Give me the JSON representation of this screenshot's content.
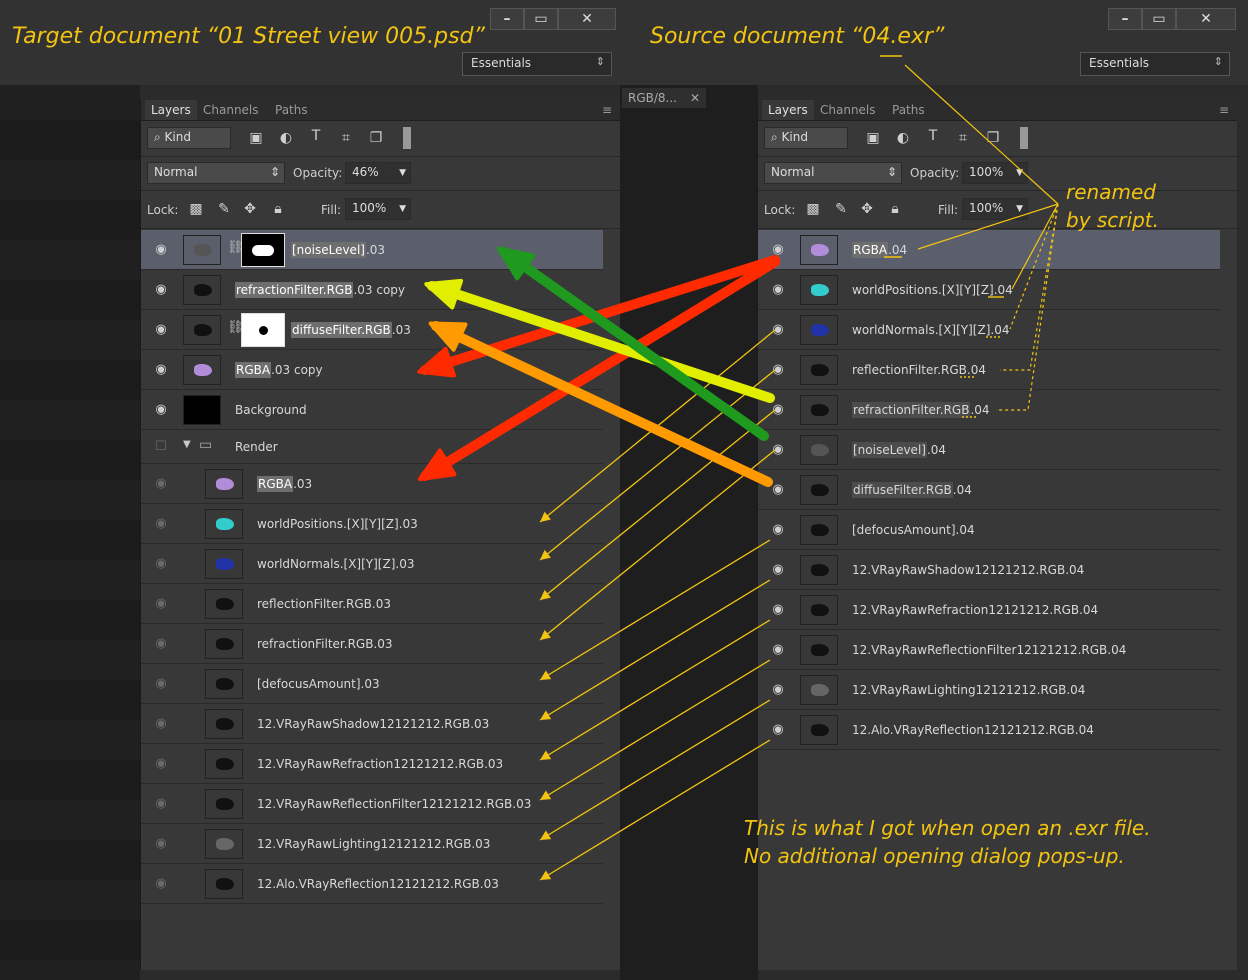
{
  "captions": {
    "target": "Target document “01 Street view 005.psd”",
    "source": "Source document “04.exr”",
    "renamed_line1": "renamed",
    "renamed_line2": "by script.",
    "note_line1": "This is what I got when open an .exr file.",
    "note_line2": "No additional opening dialog pops-up."
  },
  "window_controls": {
    "minimize": "–",
    "restore": "▭",
    "close": "✕"
  },
  "workspace": {
    "left_value": "Essentials",
    "right_value": "Essentials"
  },
  "doc_tab": {
    "label": "RGB/8...",
    "close": "✕"
  },
  "colors": {
    "caption": "#f2c411",
    "arrow_red": "#ff2a00",
    "arrow_yellow": "#e2ee00",
    "arrow_orange": "#ff9a00",
    "arrow_green": "#1f9a1f"
  },
  "left_panel": {
    "tabs": [
      "Layers",
      "Channels",
      "Paths"
    ],
    "filter_kind": "Kind",
    "blend_mode": "Normal",
    "opacity_label": "Opacity:",
    "opacity_value": "46%",
    "lock_label": "Lock:",
    "fill_label": "Fill:",
    "fill_value": "100%",
    "layers": [
      {
        "pre": "[noiseLevel]",
        "post": ".03",
        "visible": true,
        "selected": true,
        "thumb_icon": "layer-thumbnail-icon"
      },
      {
        "pre": "refractionFilter.RGB",
        "post": ".03 copy",
        "visible": true
      },
      {
        "pre": "diffuseFilter.RGB",
        "post": ".03",
        "visible": true
      },
      {
        "pre": "RGBA",
        "post": ".03 copy",
        "visible": true
      },
      {
        "pre": "Background",
        "post": "",
        "visible": true
      },
      {
        "pre": "Render",
        "post": "",
        "visible": false,
        "group": true
      },
      {
        "pre": "RGBA",
        "post": ".03",
        "visible": false
      },
      {
        "pre": "worldPositions.[X][Y][Z]",
        "post": ".03",
        "visible": false
      },
      {
        "pre": "worldNormals.[X][Y][Z]",
        "post": ".03",
        "visible": false
      },
      {
        "pre": "reflectionFilter.RGB",
        "post": ".03",
        "visible": false
      },
      {
        "pre": "refractionFilter.RGB",
        "post": ".03",
        "visible": false
      },
      {
        "pre": "[defocusAmount]",
        "post": ".03",
        "visible": false
      },
      {
        "pre": "12.VRayRawShadow12121212.RGB",
        "post": ".03",
        "visible": false
      },
      {
        "pre": "12.VRayRawRefraction12121212.RGB",
        "post": ".03",
        "visible": false
      },
      {
        "pre": "12.VRayRawReflectionFilter12121212.RGB",
        "post": ".03",
        "visible": false
      },
      {
        "pre": "12.VRayRawLighting12121212.RGB",
        "post": ".03",
        "visible": false
      },
      {
        "pre": "12.Alo.VRayReflection12121212.RGB",
        "post": ".03",
        "visible": false
      }
    ]
  },
  "right_panel": {
    "tabs": [
      "Layers",
      "Channels",
      "Paths"
    ],
    "filter_kind": "Kind",
    "blend_mode": "Normal",
    "opacity_label": "Opacity:",
    "opacity_value": "100%",
    "lock_label": "Lock:",
    "fill_label": "Fill:",
    "fill_value": "100%",
    "layers": [
      {
        "pre": "RGBA",
        "post": ".04"
      },
      {
        "pre": "worldPositions.[X][Y][Z]",
        "post": ".04"
      },
      {
        "pre": "worldNormals.[X][Y][Z]",
        "post": ".04"
      },
      {
        "pre": "reflectionFilter.RGB",
        "post": ".04"
      },
      {
        "pre": "refractionFilter.RGB",
        "post": ".04"
      },
      {
        "pre": "[noiseLevel]",
        "post": ".04"
      },
      {
        "pre": "diffuseFilter.RGB",
        "post": ".04"
      },
      {
        "pre": "[defocusAmount]",
        "post": ".04"
      },
      {
        "pre": "12.VRayRawShadow12121212.RGB",
        "post": ".04"
      },
      {
        "pre": "12.VRayRawRefraction12121212.RGB",
        "post": ".04"
      },
      {
        "pre": "12.VRayRawReflectionFilter12121212.RGB",
        "post": ".04"
      },
      {
        "pre": "12.VRayRawLighting12121212.RGB",
        "post": ".04"
      },
      {
        "pre": "12.Alo.VRayReflection12121212.RGB",
        "post": ".04"
      }
    ]
  }
}
